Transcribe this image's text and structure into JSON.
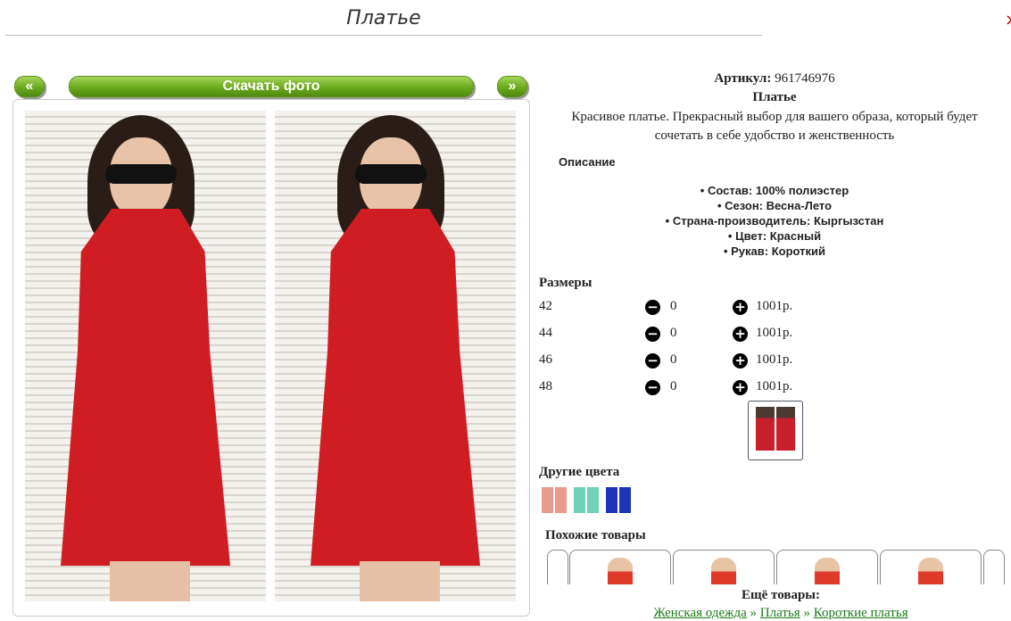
{
  "header": {
    "title": "Платье",
    "close": "×"
  },
  "gallery": {
    "prev_label": "«",
    "download_label": "Скачать фото",
    "next_label": "»"
  },
  "product": {
    "article_label": "Артикул:",
    "article_value": "961746976",
    "name": "Платье",
    "description": "Красивое платье. Прекрасный выбор для вашего образа, который будет сочетать в себе удобство и женственность",
    "description_heading": "Описание",
    "features": [
      "Состав: 100% полиэстер",
      "Сезон: Весна-Лето",
      "Страна-производитель: Кыргызстан",
      "Цвет: Красный",
      "Рукав: Короткий"
    ]
  },
  "sizes": {
    "heading": "Размеры",
    "rows": [
      {
        "size": "42",
        "qty": "0",
        "price": "1001р."
      },
      {
        "size": "44",
        "qty": "0",
        "price": "1001р."
      },
      {
        "size": "46",
        "qty": "0",
        "price": "1001р."
      },
      {
        "size": "48",
        "qty": "0",
        "price": "1001р."
      }
    ]
  },
  "other_colors": {
    "heading": "Другие цвета",
    "swatches": [
      "#e89a8e",
      "#6fd1b8",
      "#1e33b8"
    ]
  },
  "similar": {
    "heading": "Похожие товары"
  },
  "more": {
    "heading": "Ещё товары:",
    "crumb1": "Женская одежда",
    "sep": "»",
    "crumb2": "Платья",
    "crumb3": "Короткие платья"
  },
  "colors": {
    "accent_green": "#6aaa1d",
    "dress_red": "#d01d24",
    "link_green": "#1a7a1a"
  }
}
